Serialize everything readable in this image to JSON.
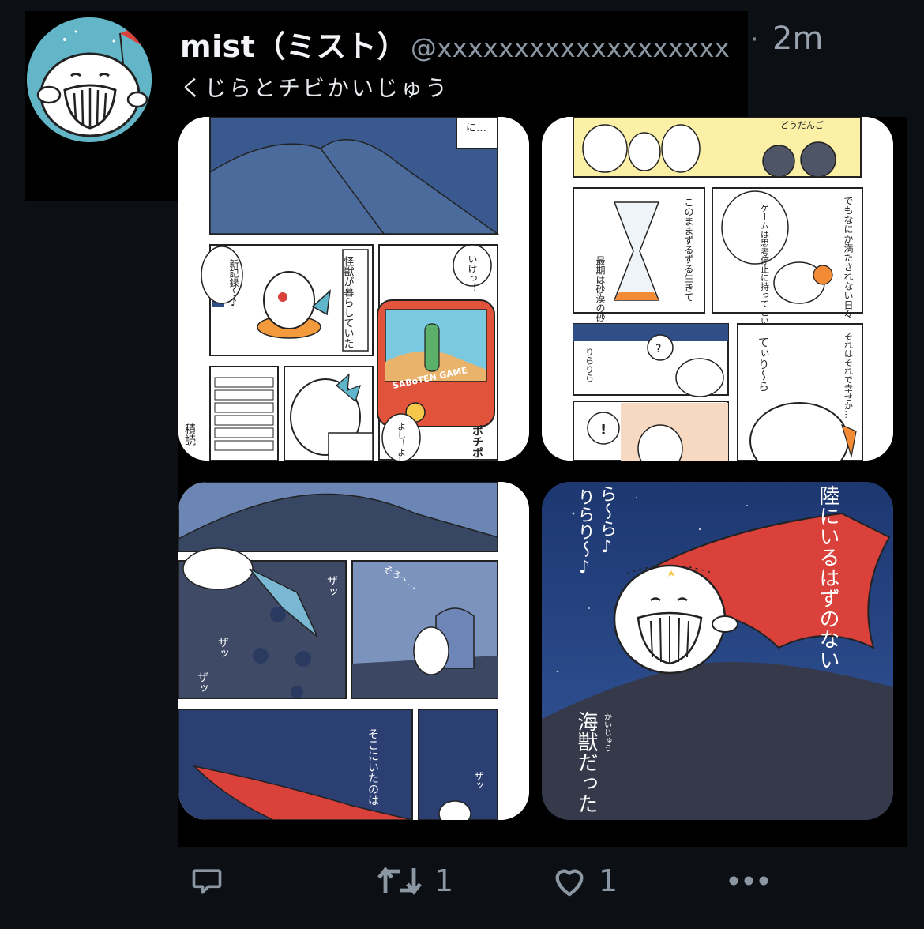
{
  "user": {
    "display_name": "mist（ミスト）",
    "handle": "@xxxxxxxxxxxxxxxxxxx",
    "separator": "·",
    "time": "2m",
    "bio": "くじらとチビかいじゅう"
  },
  "manga": {
    "p1": {
      "caption_1": "に…",
      "caption_2": "怪獣が暮らしていた",
      "speech_new_record": "新記録〜♪",
      "speech_ike": "いけっ！",
      "game_title": "SABoTEN GAME",
      "sfx_pochi": "ポチポチ",
      "speech_yoshi": "よし！よしよし",
      "text_tsundoku": "積読"
    },
    "p2": {
      "caption_doudango": "どうだんご",
      "caption_dissatisfied": "でもなにか満たされない日々",
      "speech_game": "ゲームは思考停止に持ってこいですな",
      "caption_like_this": "このままずるずる生きて",
      "caption_end": "最期は砂漠の砂と化す――",
      "caption_happy": "それはそれで幸せか…",
      "sfx_rirari_1": "てぃり〜ら",
      "sfx_rirari_2": "りらりら",
      "speech_question": "?",
      "speech_exclaim": "!"
    },
    "p3": {
      "sfx_zattsu_1": "ザッ",
      "sfx_zattsu_2": "ザッ",
      "sfx_zattsu_3": "ザッ",
      "sfx_sorori": "そろ〜…",
      "caption_there": "そこにいたのは",
      "sfx_za": "ザッ"
    },
    "p4": {
      "sfx_rara": "ら〜ら♪",
      "sfx_rirari": "りらり〜♪",
      "caption_should_not": "陸にいるはずのない",
      "caption_kaijuu": "海獣だった",
      "ruby_kaijuu": "かいじゅう"
    }
  },
  "actions": {
    "reply_count": "",
    "retweet_count": "1",
    "like_count": "1"
  },
  "icons": [
    "reply-icon",
    "retweet-icon",
    "like-icon",
    "more-icon"
  ]
}
